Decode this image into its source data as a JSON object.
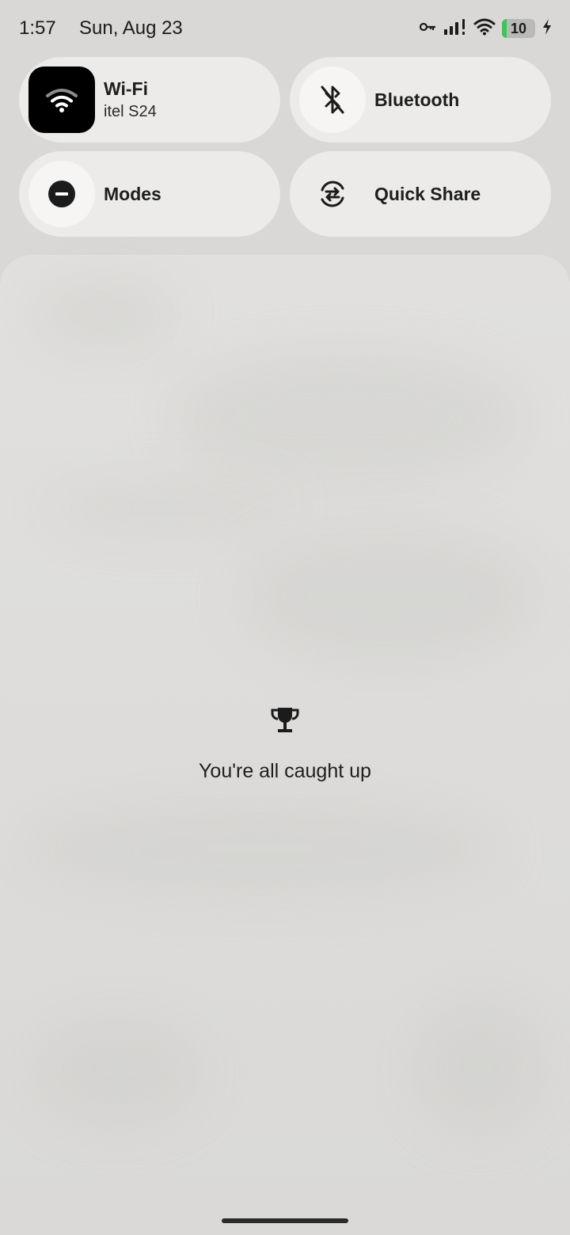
{
  "status_bar": {
    "time": "1:57",
    "date": "Sun, Aug 23",
    "battery_level": "10",
    "icons": [
      "vpn-key-icon",
      "signal-icon",
      "wifi-icon",
      "battery-icon",
      "charging-icon"
    ]
  },
  "quick_tiles": {
    "wifi": {
      "label": "Wi-Fi",
      "subtitle": "itel S24",
      "active": true,
      "icon": "wifi-icon"
    },
    "bluetooth": {
      "label": "Bluetooth",
      "active": false,
      "icon": "bluetooth-off-icon"
    },
    "modes": {
      "label": "Modes",
      "active": false,
      "icon": "do-not-disturb-icon"
    },
    "quick_share": {
      "label": "Quick Share",
      "active": false,
      "icon": "quick-share-icon"
    }
  },
  "notifications": {
    "empty_message": "You're all caught up",
    "empty_icon": "trophy-icon"
  },
  "colors": {
    "active_tile_icon_bg": "#000000",
    "battery_charge": "#3cc65a"
  }
}
